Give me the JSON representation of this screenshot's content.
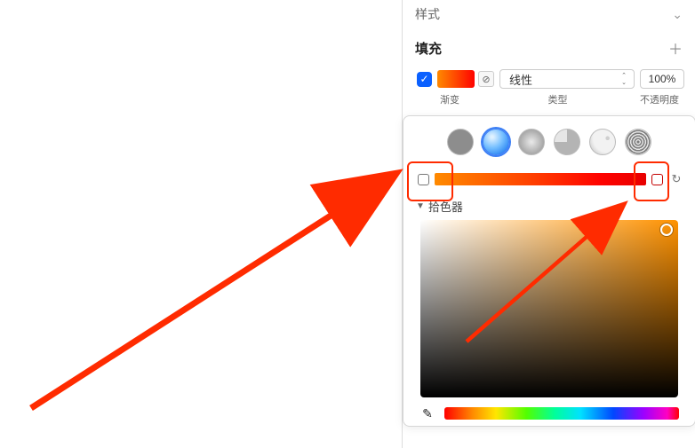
{
  "style_section": {
    "title": "样式"
  },
  "fill": {
    "title": "填充",
    "enabled": true,
    "type_value": "线性",
    "opacity_value": "100%",
    "col_labels": {
      "swatch": "渐变",
      "type": "类型",
      "opacity": "不透明度"
    }
  },
  "picker": {
    "label": "拾色器"
  },
  "icons": {
    "chevron_down": "⌄",
    "plus": "＋",
    "check": "✓",
    "link": "⊘",
    "stepper_up": "⌃",
    "stepper_down": "⌄",
    "rotate": "↻",
    "triangle": "▼",
    "eyedropper": "✎"
  },
  "gradient_type_options": [
    "solid",
    "linear",
    "radial",
    "angular",
    "image",
    "noise"
  ],
  "gradient_stops": [
    "#ff8a00",
    "#e80000"
  ],
  "color_field_hue": "#ff9200"
}
